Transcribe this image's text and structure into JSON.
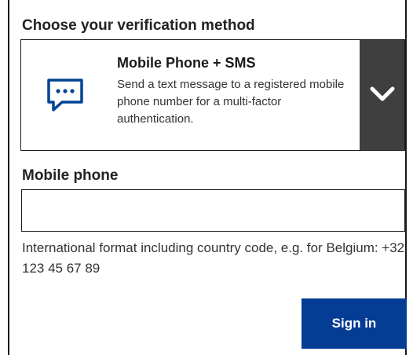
{
  "verification": {
    "title": "Choose your verification method",
    "selected_method": {
      "icon": "chat-bubble-icon",
      "title": "Mobile Phone + SMS",
      "description": "Send a text message to a registered mobile phone number for a multi-factor authentication."
    },
    "dropdown_icon": "chevron-down-icon"
  },
  "phone_field": {
    "label": "Mobile phone",
    "value": "",
    "placeholder": "",
    "help": "International format including country code, e.g. for Belgium: +32 123 45 67 89"
  },
  "actions": {
    "signin_label": "Sign in"
  },
  "colors": {
    "primary": "#053c94",
    "icon_blue": "#004494",
    "dropdown_bg": "#3f3f3f",
    "text": "#222222"
  }
}
